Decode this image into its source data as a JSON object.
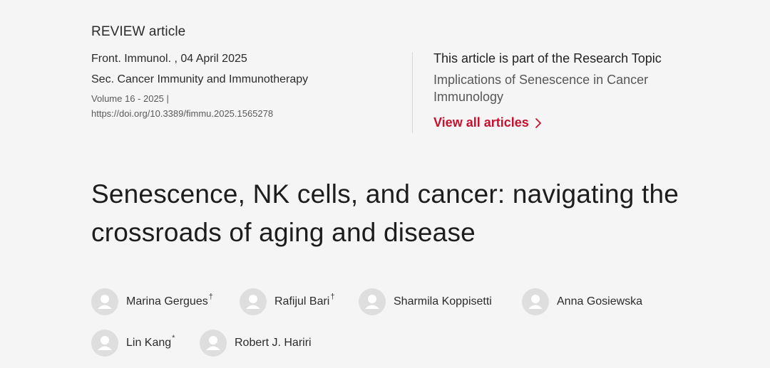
{
  "article": {
    "type_label": "REVIEW article",
    "journal_line": "Front. Immunol. , 04 April 2025",
    "section": "Sec. Cancer Immunity and Immunotherapy",
    "volume_line": "Volume 16 - 2025 |",
    "doi": "https://doi.org/10.3389/fimmu.2025.1565278",
    "title": "Senescence, NK cells, and cancer: navigating the crossroads of aging and disease"
  },
  "research_topic": {
    "heading": "This article is part of the Research Topic",
    "name": "Implications of Senescence in Cancer Immunology",
    "view_all_label": "View all articles"
  },
  "authors": [
    {
      "name": "Marina Gergues",
      "mark": "†"
    },
    {
      "name": "Rafijul Bari",
      "mark": "†"
    },
    {
      "name": "Sharmila Koppisetti",
      "mark": ""
    },
    {
      "name": "Anna Gosiewska",
      "mark": ""
    },
    {
      "name": "Lin Kang",
      "mark": "*"
    },
    {
      "name": "Robert J. Hariri",
      "mark": ""
    }
  ],
  "colors": {
    "accent": "#c8102e",
    "background": "#f5f5f5",
    "avatar_bg": "#dedede"
  },
  "icons": {
    "view_all": "chevron-right-icon",
    "author_avatar": "user-avatar-icon"
  }
}
